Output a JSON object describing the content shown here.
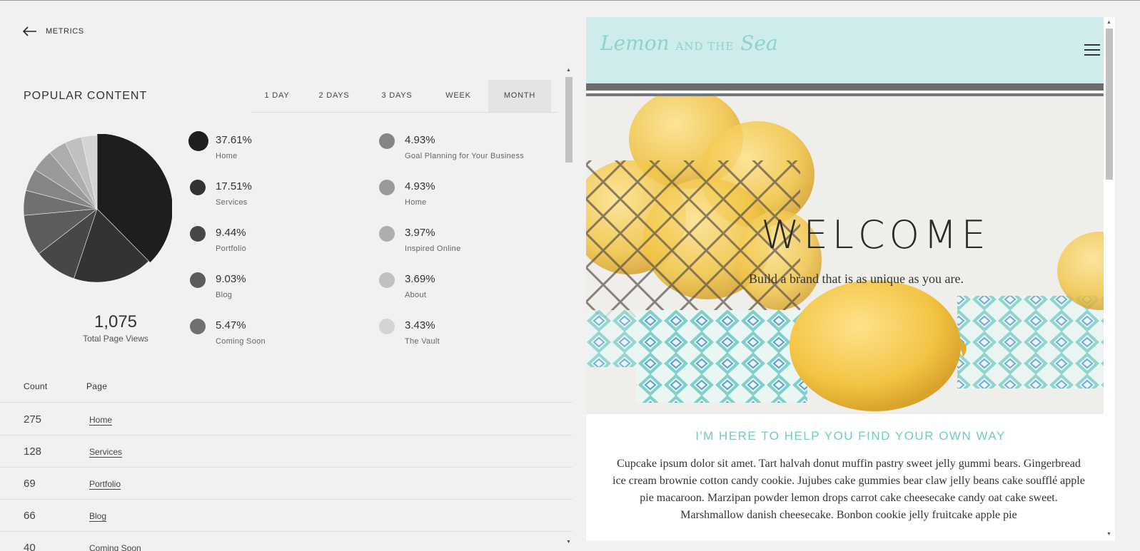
{
  "nav": {
    "back_label": "METRICS"
  },
  "popular": {
    "title": "POPULAR CONTENT",
    "ranges": [
      "1 DAY",
      "2 DAYS",
      "3 DAYS",
      "WEEK",
      "MONTH"
    ],
    "active_range": "MONTH",
    "total_views": "1,075",
    "total_label": "Total Page Views"
  },
  "legend": [
    {
      "pct": "37.61%",
      "label": "Home",
      "color": "#1e1e1e"
    },
    {
      "pct": "17.51%",
      "label": "Services",
      "color": "#333333"
    },
    {
      "pct": "9.44%",
      "label": "Portfolio",
      "color": "#474747"
    },
    {
      "pct": "9.03%",
      "label": "Blog",
      "color": "#5c5c5c"
    },
    {
      "pct": "5.47%",
      "label": "Coming Soon",
      "color": "#707070"
    },
    {
      "pct": "4.93%",
      "label": "Goal Planning for Your Business",
      "color": "#858585"
    },
    {
      "pct": "4.93%",
      "label": "Home",
      "color": "#9a9a9a"
    },
    {
      "pct": "3.97%",
      "label": "Inspired Online",
      "color": "#adadad"
    },
    {
      "pct": "3.69%",
      "label": "About",
      "color": "#c0c0c0"
    },
    {
      "pct": "3.43%",
      "label": "The Vault",
      "color": "#d4d4d4"
    }
  ],
  "chart_data": {
    "type": "pie",
    "categories": [
      "Home",
      "Services",
      "Portfolio",
      "Blog",
      "Coming Soon",
      "Goal Planning for Your Business",
      "Home",
      "Inspired Online",
      "About",
      "The Vault"
    ],
    "values": [
      37.61,
      17.51,
      9.44,
      9.03,
      5.47,
      4.93,
      4.93,
      3.97,
      3.69,
      3.43
    ],
    "title": "POPULAR CONTENT"
  },
  "table": {
    "headers": {
      "count": "Count",
      "page": "Page"
    },
    "rows": [
      {
        "count": "275",
        "page": "Home"
      },
      {
        "count": "128",
        "page": "Services"
      },
      {
        "count": "69",
        "page": "Portfolio"
      },
      {
        "count": "66",
        "page": "Blog"
      },
      {
        "count": "40",
        "page": "Coming Soon"
      }
    ]
  },
  "site": {
    "logo_main_1": "Lemon",
    "logo_small": "AND THE",
    "logo_main_2": "Sea",
    "hero_title": "WELCOME",
    "hero_tagline": "Build a brand that is as unique as you are.",
    "section_heading": "I'M HERE TO HELP YOU FIND YOUR OWN WAY",
    "body": "Cupcake ipsum dolor sit amet. Tart halvah donut muffin pastry sweet jelly gummi bears. Gingerbread ice cream brownie cotton candy cookie. Jujubes cake gummies bear claw jelly beans cake soufflé apple pie macaroon. Marzipan powder lemon drops carrot cake cheesecake candy oat cake sweet. Marshmallow danish cheesecake. Bonbon cookie jelly fruitcake apple pie",
    "colors": {
      "header_bg": "#cdeceb",
      "accent": "#6ccbc3"
    }
  }
}
